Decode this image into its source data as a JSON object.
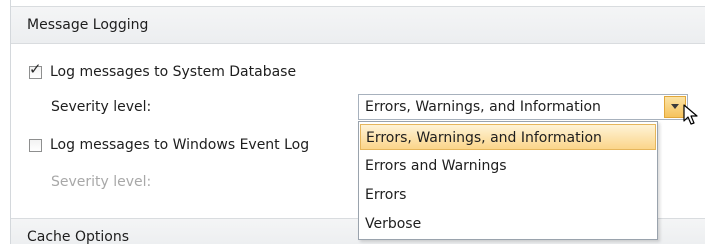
{
  "logging_section": {
    "title": "Message Logging",
    "system_db": {
      "label": "Log messages to System Database",
      "checked": true
    },
    "severity_label": "Severity level:",
    "severity_select": {
      "value": "Errors, Warnings, and Information",
      "options": [
        "Errors, Warnings, and Information",
        "Errors and Warnings",
        "Errors",
        "Verbose"
      ],
      "highlighted_option": "Errors, Warnings, and Information"
    },
    "event_log": {
      "label": "Log messages to Windows Event Log",
      "checked": false
    },
    "event_severity_label": "Severity level:"
  },
  "cache_section": {
    "title": "Cache Options"
  },
  "colors": {
    "header_bg": "#eceef0",
    "highlight": "#fbd58a",
    "arrow_button": "#f6c35d",
    "disabled_text": "#a8a8a8"
  },
  "icons": {
    "checkmark": "check-icon",
    "dropdown_arrow": "chevron-down-icon",
    "cursor": "mouse-pointer-icon"
  }
}
